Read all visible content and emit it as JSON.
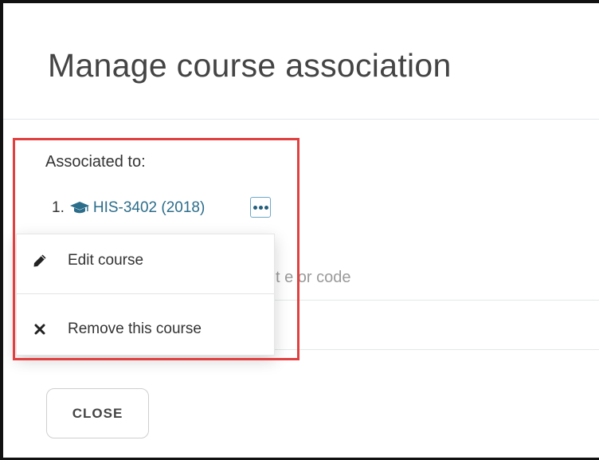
{
  "modal": {
    "title": "Manage course association"
  },
  "association": {
    "label": "Associated to:",
    "courses": [
      {
        "number": "1.",
        "name": "HIS-3402 (2018)",
        "icon": "graduation-cap-icon"
      }
    ]
  },
  "search": {
    "placeholder": "Search by title or code",
    "visible_placeholder_fragment": "tit e or code"
  },
  "context_menu": {
    "items": [
      {
        "label": "Edit course",
        "icon": "pencil-icon"
      },
      {
        "label": "Remove this course",
        "icon": "close-icon"
      }
    ]
  },
  "footer": {
    "close_label": "CLOSE"
  },
  "colors": {
    "link": "#2b6d8a",
    "highlight": "#e0403f",
    "menu_button_border": "#6ea8c7"
  }
}
